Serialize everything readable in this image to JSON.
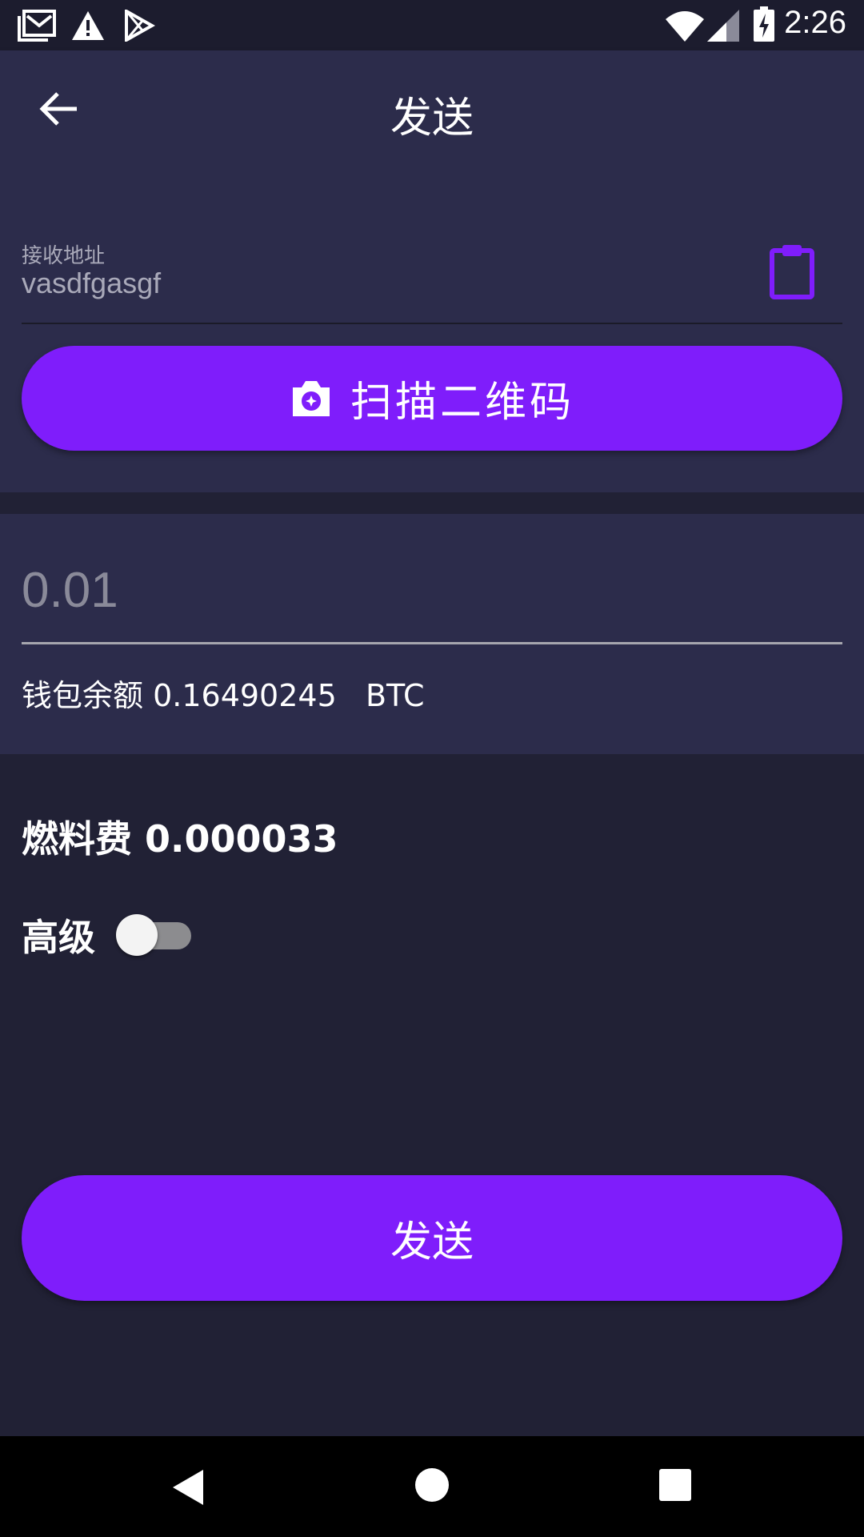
{
  "status_bar": {
    "time": "2:26",
    "left_icons": [
      "mail-icon",
      "warning-icon",
      "play-store-icon"
    ],
    "right_icons": [
      "wifi-icon",
      "signal-icon",
      "battery-charging-icon"
    ]
  },
  "app_bar": {
    "title": "发送",
    "back_icon": "arrow-back-icon"
  },
  "address": {
    "label": "接收地址",
    "value": "vasdfgasgf",
    "paste_icon": "clipboard-icon"
  },
  "scan_button": {
    "label": "扫描二维码",
    "icon": "camera-icon"
  },
  "amount": {
    "value": "0.01",
    "balance_text": "钱包余额 0.16490245   BTC"
  },
  "fee": {
    "text": "燃料费 0.000033"
  },
  "advanced": {
    "label": "高级",
    "enabled": false
  },
  "send_button": {
    "label": "发送"
  },
  "colors": {
    "accent": "#7f1dfb",
    "card": "#2c2c4b",
    "background": "#212135"
  },
  "nav_bar": {
    "icons": [
      "nav-back-icon",
      "nav-home-icon",
      "nav-recents-icon"
    ]
  }
}
